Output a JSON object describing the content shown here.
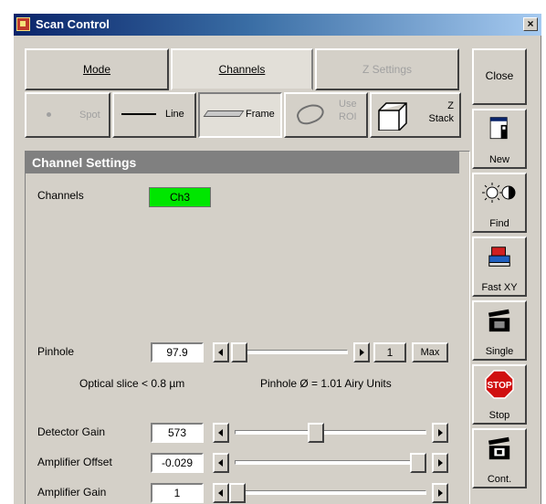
{
  "window": {
    "title": "Scan Control",
    "close_glyph": "×"
  },
  "tabs": [
    {
      "label": "Mode",
      "active": false,
      "enabled": true
    },
    {
      "label": "Channels",
      "active": true,
      "enabled": true
    },
    {
      "label": "Z Settings",
      "active": false,
      "enabled": false
    }
  ],
  "side_buttons": {
    "close": "Close",
    "new": "New",
    "find": "Find",
    "fast_xy": "Fast XY",
    "single": "Single",
    "stop": "Stop",
    "stop_sign": "STOP",
    "cont": "Cont."
  },
  "scan_modes": {
    "spot": "Spot",
    "line": "Line",
    "frame": "Frame",
    "use_roi": "Use\nROI",
    "z_stack": "Z\nStack"
  },
  "channel_settings": {
    "header": "Channel Settings",
    "channels_label": "Channels",
    "active_channel": "Ch3",
    "channel_color": "#00e600",
    "pinhole": {
      "label": "Pinhole",
      "value": "97.9",
      "airy_value": "1",
      "max_label": "Max",
      "level": 0.02
    },
    "optical_slice": "Optical slice < 0.8 µm",
    "pinhole_airy": "Pinhole Ø = 1.01 Airy Units",
    "detector_gain": {
      "label": "Detector Gain",
      "value": "573",
      "level": 0.42
    },
    "amplifier_offset": {
      "label": "Amplifier Offset",
      "value": "-0.029",
      "level": 0.97
    },
    "amplifier_gain": {
      "label": "Amplifier Gain",
      "value": "1",
      "level": 0.0
    }
  }
}
